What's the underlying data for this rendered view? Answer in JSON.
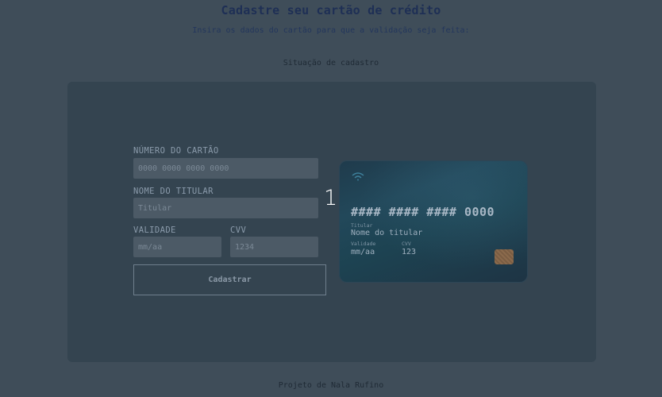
{
  "page": {
    "title": "Cadastre seu cartão de crédito",
    "subtitle": "Insira os dados do cartão para que a validação seja feita:",
    "status_label": "Situação de cadastro",
    "footer": "Projeto de Nala Rufino"
  },
  "form": {
    "number_label": "NÚMERO DO CARTÃO",
    "number_placeholder": "0000 0000 0000 0000",
    "holder_label": "NOME DO TITULAR",
    "holder_placeholder": "Titular",
    "validity_label": "VALIDADE",
    "validity_placeholder": "mm/aa",
    "cvv_label": "CVV",
    "cvv_placeholder": "1234",
    "submit_label": "Cadastrar"
  },
  "step": {
    "number": "1"
  },
  "card": {
    "number": "#### #### #### 0000",
    "holder_label": "Titular",
    "holder": "Nome do titular",
    "validity_label": "Validade",
    "validity": "mm/aa",
    "cvv_label": "CVV",
    "cvv": "123",
    "icons": {
      "contactless": "wifi-icon",
      "chip": "chip-icon"
    },
    "colors": {
      "gradient_start": "#1f3b4c",
      "gradient_end": "#1e3444",
      "chip": "#8b6a4c"
    }
  },
  "colors": {
    "background": "#3f4d59",
    "panel": "#344450",
    "title": "#1e2f55"
  }
}
